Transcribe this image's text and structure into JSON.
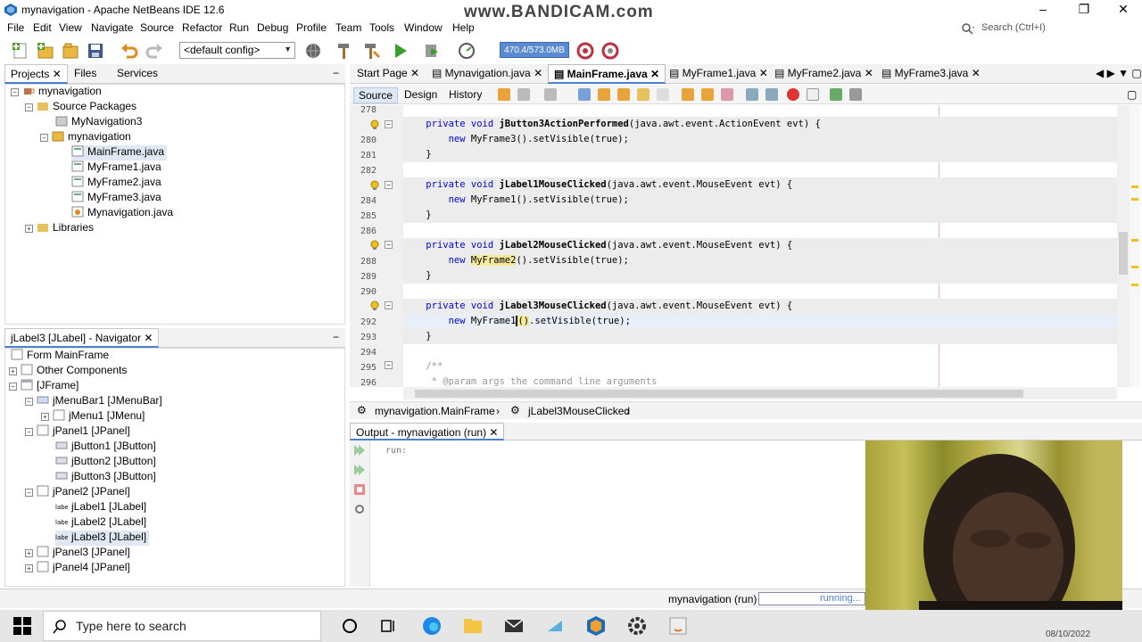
{
  "window": {
    "title": "mynavigation - Apache NetBeans IDE 12.6",
    "watermark": "www.BANDICAM.com",
    "controls": [
      "–",
      "❐",
      "✕"
    ]
  },
  "menu": [
    "File",
    "Edit",
    "View",
    "Navigate",
    "Source",
    "Refactor",
    "Run",
    "Debug",
    "Profile",
    "Team",
    "Tools",
    "Window",
    "Help"
  ],
  "search": {
    "placeholder": "Search (Ctrl+I)"
  },
  "toolbar": {
    "config": "<default config>",
    "memory": "470.4/573.0MB"
  },
  "projects_panel": {
    "tabs": [
      "Projects",
      "Files",
      "Services"
    ],
    "tree": [
      {
        "label": "mynavigation"
      },
      {
        "label": "Source Packages"
      },
      {
        "label": "MyNavigation3"
      },
      {
        "label": "mynavigation"
      },
      {
        "label": "MainFrame.java"
      },
      {
        "label": "MyFrame1.java"
      },
      {
        "label": "MyFrame2.java"
      },
      {
        "label": "MyFrame3.java"
      },
      {
        "label": "Mynavigation.java"
      },
      {
        "label": "Libraries"
      }
    ]
  },
  "navigator_panel": {
    "title": "jLabel3 [JLabel] - Navigator",
    "tree": [
      {
        "label": "Form MainFrame"
      },
      {
        "label": "Other Components"
      },
      {
        "label": "[JFrame]"
      },
      {
        "label": "jMenuBar1 [JMenuBar]"
      },
      {
        "label": "jMenu1 [JMenu]"
      },
      {
        "label": "jPanel1 [JPanel]"
      },
      {
        "label": "jButton1 [JButton]"
      },
      {
        "label": "jButton2 [JButton]"
      },
      {
        "label": "jButton3 [JButton]"
      },
      {
        "label": "jPanel2 [JPanel]"
      },
      {
        "label": "jLabel1 [JLabel]"
      },
      {
        "label": "jLabel2 [JLabel]"
      },
      {
        "label": "jLabel3 [JLabel]"
      },
      {
        "label": "jPanel3 [JPanel]"
      },
      {
        "label": "jPanel4 [JPanel]"
      }
    ]
  },
  "editor": {
    "tabs": [
      "Start Page",
      "Mynavigation.java",
      "MainFrame.java",
      "MyFrame1.java",
      "MyFrame2.java",
      "MyFrame3.java"
    ],
    "views": [
      "Source",
      "Design",
      "History"
    ],
    "line_numbers": [
      "278",
      "279",
      "280",
      "281",
      "282",
      "283",
      "284",
      "285",
      "286",
      "287",
      "288",
      "289",
      "290",
      "291",
      "292",
      "293",
      "294",
      "295",
      "296"
    ],
    "code": {
      "l279a": "private void ",
      "l279b": "jButton3ActionPerformed",
      "l279c": "(java.awt.event.ActionEvent evt) {",
      "l280a": "new ",
      "l280b": "MyFrame3().setVisible(true);",
      "l281": "}",
      "l283a": "private void ",
      "l283b": "jLabel1MouseClicked",
      "l283c": "(java.awt.event.MouseEvent evt) {",
      "l284a": "new ",
      "l284b": "MyFrame1().setVisible(true);",
      "l285": "}",
      "l287a": "private void ",
      "l287b": "jLabel2MouseClicked",
      "l287c": "(java.awt.event.MouseEvent evt) {",
      "l288a": "new ",
      "l288b": "MyFrame2",
      "l288c": "().setVisible(true);",
      "l289": "}",
      "l291a": "private void ",
      "l291b": "jLabel3MouseClicked",
      "l291c": "(java.awt.event.MouseEvent evt) {",
      "l292a": "new ",
      "l292b": "MyFrame1",
      "l292c": "()",
      "l292d": ".setVisible(true);",
      "l293": "}",
      "l295": "/**",
      "l296": " * @param args the command line arguments"
    },
    "breadcrumb": [
      "mynavigation.MainFrame",
      "jLabel3MouseClicked"
    ]
  },
  "output": {
    "tab": "Output - mynavigation (run)",
    "text": "run:"
  },
  "status": {
    "task": "mynavigation (run)",
    "progress": "running..."
  },
  "taskbar": {
    "search_placeholder": "Type here to search",
    "date": "08/10/2022"
  }
}
